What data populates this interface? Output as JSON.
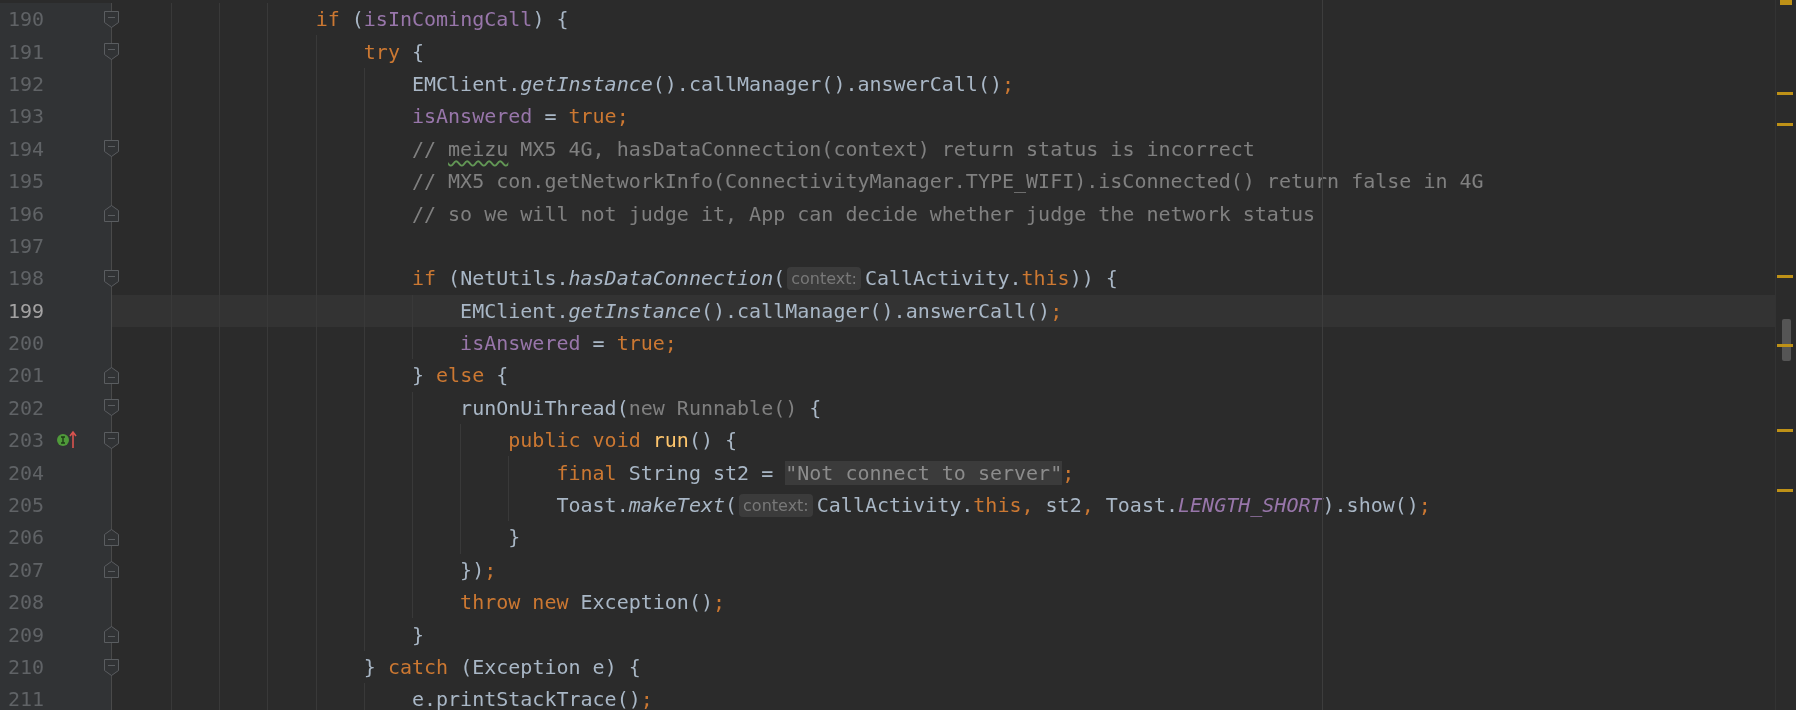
{
  "editor": {
    "lines": [
      {
        "number": "190",
        "current": false,
        "fold_start": true,
        "fold_end": false,
        "implements": false,
        "tokens": [
          {
            "kind": "keyword",
            "text": "if"
          },
          {
            "kind": "plain",
            "text": " ("
          },
          {
            "kind": "field",
            "text": "isInComingCall"
          },
          {
            "kind": "plain",
            "text": ") {"
          }
        ],
        "children": [
          {
            "number": "191",
            "current": false,
            "fold_start": true,
            "fold_end": false,
            "implements": false,
            "tokens": [
              {
                "kind": "keyword",
                "text": "try"
              },
              {
                "kind": "plain",
                "text": " {"
              }
            ],
            "children": [
              {
                "number": "192",
                "current": false,
                "fold_start": false,
                "fold_end": false,
                "implements": false,
                "tokens": [
                  {
                    "kind": "plain",
                    "text": "EMClient."
                  },
                  {
                    "kind": "italic",
                    "text": "getInstance"
                  },
                  {
                    "kind": "plain",
                    "text": "().callManager().answerCall()"
                  },
                  {
                    "kind": "keyword",
                    "text": ";"
                  }
                ]
              },
              {
                "number": "193",
                "current": false,
                "fold_start": false,
                "fold_end": false,
                "implements": false,
                "tokens": [
                  {
                    "kind": "field",
                    "text": "isAnswered"
                  },
                  {
                    "kind": "plain",
                    "text": " = "
                  },
                  {
                    "kind": "keyword",
                    "text": "true;"
                  }
                ]
              },
              {
                "number": "194",
                "current": false,
                "fold_start": true,
                "fold_end": false,
                "implements": false,
                "tokens": [
                  {
                    "kind": "comment",
                    "text": "// "
                  },
                  {
                    "kind": "typo",
                    "text": "meizu"
                  },
                  {
                    "kind": "comment",
                    "text": " MX5 4G, hasDataConnection(context) return status is incorrect"
                  }
                ]
              },
              {
                "number": "195",
                "current": false,
                "fold_start": false,
                "fold_end": false,
                "implements": false,
                "tokens": [
                  {
                    "kind": "comment",
                    "text": "// MX5 con.getNetworkInfo(ConnectivityManager.TYPE_WIFI).isConnected() return false in 4G"
                  }
                ]
              },
              {
                "number": "196",
                "current": false,
                "fold_start": false,
                "fold_end": true,
                "implements": false,
                "tokens": [
                  {
                    "kind": "comment",
                    "text": "// so we will not judge it, App can decide whether judge the network status"
                  }
                ]
              },
              {
                "number": "197",
                "current": false,
                "fold_start": false,
                "fold_end": false,
                "implements": false
              },
              {
                "number": "198",
                "current": false,
                "fold_start": true,
                "fold_end": false,
                "implements": false,
                "tokens": [
                  {
                    "kind": "keyword",
                    "text": "if"
                  },
                  {
                    "kind": "plain",
                    "text": " (NetUtils."
                  },
                  {
                    "kind": "italic",
                    "text": "hasDataConnection"
                  },
                  {
                    "kind": "plain",
                    "text": "("
                  },
                  {
                    "kind": "hint",
                    "text": "context:"
                  },
                  {
                    "kind": "plain",
                    "text": "CallActivity."
                  },
                  {
                    "kind": "keyword",
                    "text": "this"
                  },
                  {
                    "kind": "plain",
                    "text": ")) {"
                  }
                ],
                "children": [
                  {
                    "number": "199",
                    "current": true,
                    "fold_start": false,
                    "fold_end": false,
                    "implements": false,
                    "tokens": [
                      {
                        "kind": "plain",
                        "text": "EMClient."
                      },
                      {
                        "kind": "italic",
                        "text": "getInstance"
                      },
                      {
                        "kind": "plain",
                        "text": "().callManager().answerCall()"
                      },
                      {
                        "kind": "keyword",
                        "text": ";"
                      }
                    ]
                  },
                  {
                    "number": "200",
                    "current": false,
                    "fold_start": false,
                    "fold_end": false,
                    "implements": false,
                    "tokens": [
                      {
                        "kind": "field",
                        "text": "isAnswered"
                      },
                      {
                        "kind": "plain",
                        "text": " = "
                      },
                      {
                        "kind": "keyword",
                        "text": "true;"
                      }
                    ]
                  }
                ]
              },
              {
                "number": "201",
                "current": false,
                "fold_start": false,
                "fold_end": true,
                "implements": false,
                "tokens": [
                  {
                    "kind": "plain",
                    "text": "} "
                  },
                  {
                    "kind": "keyword",
                    "text": "else"
                  },
                  {
                    "kind": "plain",
                    "text": " {"
                  }
                ],
                "children": [
                  {
                    "number": "202",
                    "current": false,
                    "fold_start": true,
                    "fold_end": false,
                    "implements": false,
                    "tokens": [
                      {
                        "kind": "plain",
                        "text": "runOnUiThread("
                      },
                      {
                        "kind": "dim",
                        "text": "new Runnable()"
                      },
                      {
                        "kind": "plain",
                        "text": " {"
                      }
                    ],
                    "children": [
                      {
                        "number": "203",
                        "current": false,
                        "fold_start": true,
                        "fold_end": false,
                        "implements": true,
                        "tokens": [
                          {
                            "kind": "keyword",
                            "text": "public void "
                          },
                          {
                            "kind": "decl",
                            "text": "run"
                          },
                          {
                            "kind": "plain",
                            "text": "() {"
                          }
                        ],
                        "children": [
                          {
                            "number": "204",
                            "current": false,
                            "fold_start": false,
                            "fold_end": false,
                            "implements": false,
                            "tokens": [
                              {
                                "kind": "keyword",
                                "text": "final"
                              },
                              {
                                "kind": "plain",
                                "text": " String st2 = "
                              },
                              {
                                "kind": "string",
                                "text": "\"Not connect to server\""
                              },
                              {
                                "kind": "keyword",
                                "text": ";"
                              }
                            ]
                          },
                          {
                            "number": "205",
                            "current": false,
                            "fold_start": false,
                            "fold_end": false,
                            "implements": false,
                            "tokens": [
                              {
                                "kind": "plain",
                                "text": "Toast."
                              },
                              {
                                "kind": "italic",
                                "text": "makeText"
                              },
                              {
                                "kind": "plain",
                                "text": "("
                              },
                              {
                                "kind": "hint",
                                "text": "context:"
                              },
                              {
                                "kind": "plain",
                                "text": "CallActivity."
                              },
                              {
                                "kind": "keyword",
                                "text": "this, "
                              },
                              {
                                "kind": "plain",
                                "text": "st2"
                              },
                              {
                                "kind": "keyword",
                                "text": ", "
                              },
                              {
                                "kind": "plain",
                                "text": "Toast."
                              },
                              {
                                "kind": "const",
                                "text": "LENGTH_SHORT"
                              },
                              {
                                "kind": "plain",
                                "text": ").show()"
                              },
                              {
                                "kind": "keyword",
                                "text": ";"
                              }
                            ]
                          }
                        ]
                      },
                      {
                        "number": "206",
                        "current": false,
                        "fold_start": false,
                        "fold_end": true,
                        "implements": false,
                        "tokens": [
                          {
                            "kind": "plain",
                            "text": "}"
                          }
                        ]
                      }
                    ]
                  },
                  {
                    "number": "207",
                    "current": false,
                    "fold_start": false,
                    "fold_end": true,
                    "implements": false,
                    "tokens": [
                      {
                        "kind": "plain",
                        "text": "})"
                      },
                      {
                        "kind": "keyword",
                        "text": ";"
                      }
                    ]
                  },
                  {
                    "number": "208",
                    "current": false,
                    "fold_start": false,
                    "fold_end": false,
                    "implements": false,
                    "tokens": [
                      {
                        "kind": "keyword",
                        "text": "throw new"
                      },
                      {
                        "kind": "plain",
                        "text": " Exception()"
                      },
                      {
                        "kind": "keyword",
                        "text": ";"
                      }
                    ]
                  }
                ]
              },
              {
                "number": "209",
                "current": false,
                "fold_start": false,
                "fold_end": true,
                "implements": false,
                "tokens": [
                  {
                    "kind": "plain",
                    "text": "}"
                  }
                ]
              }
            ]
          },
          {
            "number": "210",
            "current": false,
            "fold_start": true,
            "fold_end": false,
            "implements": false,
            "tokens": [
              {
                "kind": "plain",
                "text": "} "
              },
              {
                "kind": "keyword",
                "text": "catch"
              },
              {
                "kind": "plain",
                "text": " (Exception e) {"
              }
            ],
            "children": [
              {
                "number": "211",
                "current": false,
                "fold_start": false,
                "fold_end": false,
                "implements": false,
                "tokens": [
                  {
                    "kind": "plain",
                    "text": "e.printStackTrace()"
                  },
                  {
                    "kind": "keyword",
                    "text": ";"
                  }
                ]
              }
            ]
          }
        ]
      }
    ]
  }
}
